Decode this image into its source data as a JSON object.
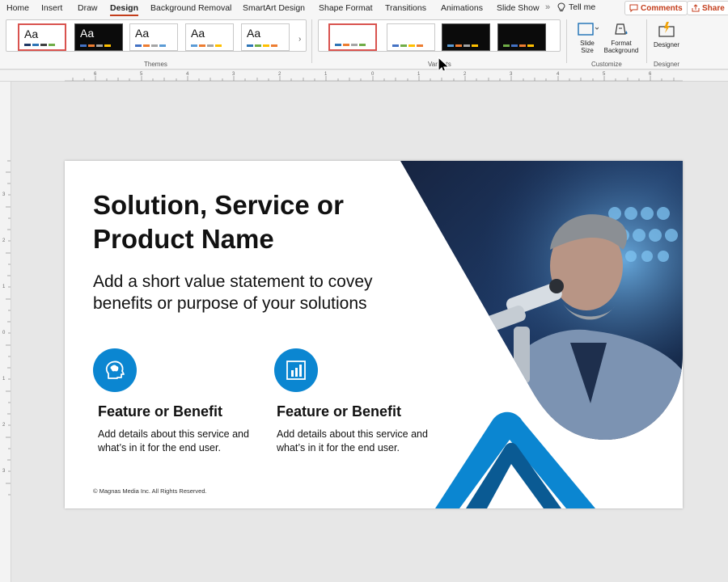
{
  "tabs": [
    {
      "label": "Home",
      "active": false
    },
    {
      "label": "Insert",
      "active": false
    },
    {
      "label": "Draw",
      "active": false
    },
    {
      "label": "Design",
      "active": true
    },
    {
      "label": "Background Removal",
      "active": false
    },
    {
      "label": "SmartArt Design",
      "active": false
    },
    {
      "label": "Shape Format",
      "active": false
    },
    {
      "label": "Transitions",
      "active": false
    },
    {
      "label": "Animations",
      "active": false
    },
    {
      "label": "Slide Show",
      "active": false
    }
  ],
  "tell_me": "Tell me",
  "comments_label": "Comments",
  "share_label": "Share",
  "themes": {
    "group_label": "Themes",
    "thumb_text": "Aa",
    "items": [
      {
        "style": "light",
        "selected": true
      },
      {
        "style": "dark",
        "selected": false
      },
      {
        "style": "light",
        "selected": false
      },
      {
        "style": "light",
        "selected": false
      },
      {
        "style": "light",
        "selected": false
      }
    ]
  },
  "variants": {
    "group_label": "Variants",
    "items": [
      {
        "style": "light",
        "selected": true
      },
      {
        "style": "light",
        "selected": false
      },
      {
        "style": "dark",
        "selected": false
      },
      {
        "style": "dark",
        "selected": false
      }
    ]
  },
  "customize": {
    "group_label": "Customize",
    "slide_size_label": "Slide Size",
    "format_background_label": "Format Background"
  },
  "designer": {
    "group_label": "Designer",
    "button_label": "Designer"
  },
  "slide": {
    "title": "Solution, Service or Product Name",
    "subtitle": "Add a short value statement to covey benefits or purpose of your solutions",
    "features": [
      {
        "icon": "brain-head-icon",
        "title": "Feature or Benefit",
        "desc": "Add details about this service and what’s in it for the end user."
      },
      {
        "icon": "bar-chart-icon",
        "title": "Feature or Benefit",
        "desc": "Add details about this service and what’s in it for the end user."
      }
    ],
    "copyright": "© Magnas Media Inc. All Rights Reserved."
  },
  "colors": {
    "accent_red": "#c43e1c",
    "brand_blue": "#0b86d1",
    "dark_blue": "#0a5a93"
  }
}
